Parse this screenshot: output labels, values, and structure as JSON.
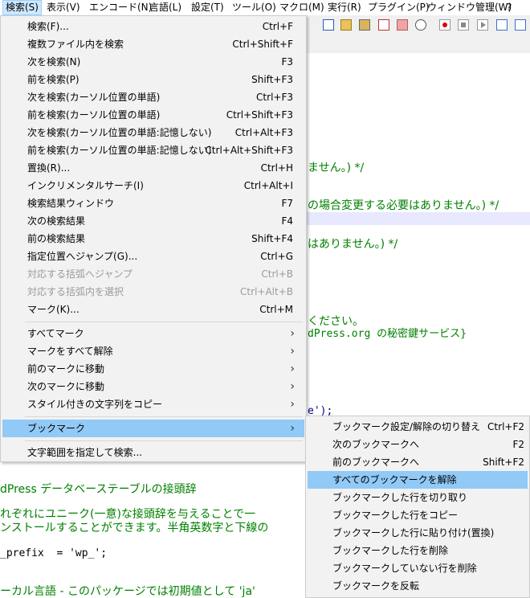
{
  "menubar": [
    {
      "label": "検索(S)",
      "active": true
    },
    {
      "label": "表示(V)"
    },
    {
      "label": "エンコード(N)"
    },
    {
      "label": "言語(L)"
    },
    {
      "label": "設定(T)"
    },
    {
      "label": "ツール(O)"
    },
    {
      "label": "マクロ(M)"
    },
    {
      "label": "実行(R)"
    },
    {
      "label": "プラグイン(P)"
    },
    {
      "label": "ウィンドウ管理(W)"
    },
    {
      "label": "?"
    }
  ],
  "toolbar_icons": [
    "wrap-icon",
    "indent-guide-icon",
    "doc-map-icon",
    "function-list-icon",
    "folder-workspace-icon",
    "monitoring-icon",
    "record-macro-icon",
    "stop-macro-icon",
    "play-macro-icon",
    "run-macro-multiple-icon",
    "save-macro-icon"
  ],
  "editor_lines": [
    {
      "text": "ません。) */",
      "mono": false,
      "color": "#008000"
    },
    {
      "text": "の場合変更する必要はありません。) */",
      "mono": false,
      "color": "#008000"
    },
    {
      "text": "はありません。) */",
      "mono": false,
      "color": "#008000"
    },
    {
      "text": "ください。",
      "mono": false,
      "color": "#008000"
    },
    {
      "text": "dPress.org の秘密鍵サービス}",
      "mono": true,
      "color": "#008000"
    },
    {
      "text": "e');",
      "mono": true,
      "color": "#000080"
    },
    {
      "text": "dPress データベーステーブルの接頭辞",
      "mono": false,
      "color": "#008000"
    },
    {
      "text": "れぞれにユニーク(一意)な接頭辞を与えることで一",
      "mono": false,
      "color": "#008000"
    },
    {
      "text": "ンストールすることができます。半角英数字と下線の",
      "mono": false,
      "color": "#008000"
    },
    {
      "text": "_prefix  = 'wp_';",
      "mono": true,
      "color": "#000000"
    },
    {
      "text": "ーカル言語 - このパッケージでは初期値として 'ja'",
      "mono": false,
      "color": "#008000"
    }
  ],
  "search_menu": [
    {
      "label": "検索(F)...",
      "shortcut": "Ctrl+F"
    },
    {
      "label": "複数ファイル内を検索",
      "shortcut": "Ctrl+Shift+F"
    },
    {
      "label": "次を検索(N)",
      "shortcut": "F3"
    },
    {
      "label": "前を検索(P)",
      "shortcut": "Shift+F3"
    },
    {
      "label": "次を検索(カーソル位置の単語)",
      "shortcut": "Ctrl+F3"
    },
    {
      "label": "前を検索(カーソル位置の単語)",
      "shortcut": "Ctrl+Shift+F3"
    },
    {
      "label": "次を検索(カーソル位置の単語:記憶しない)",
      "shortcut": "Ctrl+Alt+F3"
    },
    {
      "label": "前を検索(カーソル位置の単語:記憶しない)",
      "shortcut": "Ctrl+Alt+Shift+F3"
    },
    {
      "label": "置換(R)...",
      "shortcut": "Ctrl+H"
    },
    {
      "label": "インクリメンタルサーチ(I)",
      "shortcut": "Ctrl+Alt+I"
    },
    {
      "label": "検索結果ウィンドウ",
      "shortcut": "F7"
    },
    {
      "label": "次の検索結果",
      "shortcut": "F4"
    },
    {
      "label": "前の検索結果",
      "shortcut": "Shift+F4"
    },
    {
      "label": "指定位置へジャンプ(G)...",
      "shortcut": "Ctrl+G"
    },
    {
      "label": "対応する括弧へジャンプ",
      "shortcut": "Ctrl+B",
      "disabled": true
    },
    {
      "label": "対応する括弧内を選択",
      "shortcut": "Ctrl+Alt+B",
      "disabled": true
    },
    {
      "label": "マーク(K)...",
      "shortcut": "Ctrl+M"
    },
    {
      "separator": true
    },
    {
      "label": "すべてマーク",
      "submenu": true
    },
    {
      "label": "マークをすべて解除",
      "submenu": true
    },
    {
      "label": "前のマークに移動",
      "submenu": true
    },
    {
      "label": "次のマークに移動",
      "submenu": true
    },
    {
      "label": "スタイル付きの文字列をコピー",
      "submenu": true
    },
    {
      "separator": true
    },
    {
      "label": "ブックマーク",
      "submenu": true,
      "highlighted": true
    },
    {
      "separator": true
    },
    {
      "label": "文字範囲を指定して検索..."
    }
  ],
  "bookmark_menu": [
    {
      "label": "ブックマーク設定/解除の切り替え",
      "shortcut": "Ctrl+F2"
    },
    {
      "label": "次のブックマークへ",
      "shortcut": "F2"
    },
    {
      "label": "前のブックマークへ",
      "shortcut": "Shift+F2"
    },
    {
      "label": "すべてのブックマークを解除",
      "highlighted": true
    },
    {
      "label": "ブックマークした行を切り取り"
    },
    {
      "label": "ブックマークした行をコピー"
    },
    {
      "label": "ブックマークした行に貼り付け(置換)"
    },
    {
      "label": "ブックマークした行を削除"
    },
    {
      "label": "ブックマークしていない行を削除"
    },
    {
      "label": "ブックマークを反転"
    }
  ],
  "colors": {
    "highlight": "#91c9f7",
    "menu_bg": "#f2f2f2",
    "active_menubar": "#cce8ff",
    "comment_green": "#008000"
  }
}
